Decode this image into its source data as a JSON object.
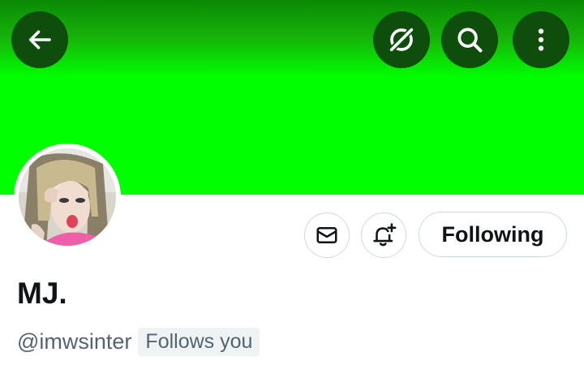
{
  "header": {
    "buttons": [
      {
        "icon": "back-arrow-icon"
      },
      {
        "icon": "grok-icon"
      },
      {
        "icon": "search-icon"
      },
      {
        "icon": "more-vertical-icon"
      }
    ]
  },
  "colors": {
    "banner": "#00ff00",
    "header_button_bg": "#0e4d0c",
    "text_primary": "#0f1419",
    "text_secondary": "#536471",
    "border": "#cfd9de",
    "badge_bg": "#eff3f4"
  },
  "profile": {
    "display_name": "MJ.",
    "handle": "@imwsinter",
    "follows_you_label": "Follows you",
    "avatar": "profile-photo"
  },
  "actions": {
    "message_icon": "mail-icon",
    "notify_icon": "bell-plus-icon",
    "following_label": "Following"
  }
}
